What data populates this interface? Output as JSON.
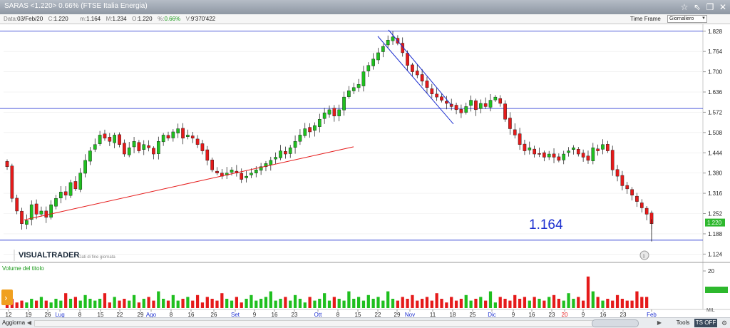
{
  "window": {
    "title": "SARAS <1.220> 0.66%  (FTSE Italia Energia)",
    "icons": [
      "star-icon",
      "expand-arrow-icon",
      "restore-icon",
      "close-icon"
    ]
  },
  "info_bar": {
    "date_label": "Data:",
    "date_value": "03/Feb/20",
    "close_label": "C:",
    "close_value": "1.220",
    "min_label": "m:",
    "min_value": "1.164",
    "max_label": "M:",
    "max_value": "1.234",
    "open_label": "O:",
    "open_value": "1.220",
    "pct_label": "%:",
    "pct_value": "0.66%",
    "volume_label": "V:",
    "volume_value": "9'370'422",
    "timeframe_label": "Time Frame",
    "timeframe_value": "Giornaliero"
  },
  "colors": {
    "up": "#1fbf1f",
    "down": "#e51a1a",
    "trendline": "#e51a1a",
    "channel": "#1c2fd0",
    "hline": "#1c2fd0",
    "accent_text": "#1c2fd0"
  },
  "chart_data": {
    "type": "candlestick",
    "title": "SARAS <1.220> 0.66%",
    "price_axis": {
      "ylim": [
        1.1,
        1.85
      ],
      "ticks": [
        "1.828",
        "1.764",
        "1.700",
        "1.636",
        "1.572",
        "1.508",
        "1.444",
        "1.380",
        "1.316",
        "1.252",
        "1.188",
        "1.124"
      ]
    },
    "last_price_label": "1.220",
    "annotation": "1.164",
    "watermark": "VISUALTRADER",
    "watermark_sub": "Dati di fine giornata",
    "volume_panel": {
      "label": "Volume del titolo",
      "ticks": [
        "20"
      ],
      "axis_unit": "MIL"
    },
    "x_tick_labels": [
      "12",
      "19",
      "26",
      "Lug",
      "8",
      "15",
      "22",
      "29",
      "Ago",
      "8",
      "16",
      "26",
      "Set",
      "9",
      "16",
      "23",
      "Ott",
      "8",
      "15",
      "22",
      "29",
      "Nov",
      "11",
      "18",
      "25",
      "Dic",
      "9",
      "16",
      "23",
      "20",
      "9",
      "16",
      "23",
      "Feb"
    ],
    "highlight_ticks": [
      "Lug",
      "Ago",
      "Set",
      "Ott",
      "Nov",
      "Dic",
      "Feb"
    ],
    "red_ticks": [
      "20"
    ],
    "horizontal_lines": [
      1.828,
      1.584,
      1.168
    ],
    "trendline": {
      "from": [
        1.232,
        34
      ],
      "to": [
        1.463,
        496
      ]
    },
    "channel": {
      "upper": [
        [
          1.832,
          545
        ],
        [
          1.595,
          633
        ]
      ],
      "lower": [
        [
          1.812,
          530
        ],
        [
          1.535,
          636
        ]
      ]
    },
    "candles": [
      1.4,
      1.3,
      1.26,
      1.22,
      1.23,
      1.28,
      1.25,
      1.26,
      1.24,
      1.28,
      1.3,
      1.32,
      1.31,
      1.35,
      1.33,
      1.38,
      1.42,
      1.45,
      1.47,
      1.5,
      1.49,
      1.48,
      1.5,
      1.47,
      1.44,
      1.46,
      1.48,
      1.45,
      1.47,
      1.46,
      1.44,
      1.48,
      1.5,
      1.49,
      1.51,
      1.52,
      1.49,
      1.5,
      1.49,
      1.47,
      1.45,
      1.42,
      1.39,
      1.38,
      1.37,
      1.38,
      1.39,
      1.38,
      1.36,
      1.37,
      1.38,
      1.39,
      1.4,
      1.41,
      1.42,
      1.43,
      1.45,
      1.44,
      1.46,
      1.48,
      1.5,
      1.52,
      1.51,
      1.53,
      1.55,
      1.57,
      1.58,
      1.56,
      1.58,
      1.62,
      1.64,
      1.65,
      1.66,
      1.7,
      1.72,
      1.74,
      1.76,
      1.78,
      1.8,
      1.81,
      1.79,
      1.76,
      1.72,
      1.7,
      1.69,
      1.67,
      1.65,
      1.63,
      1.62,
      1.61,
      1.6,
      1.59,
      1.58,
      1.57,
      1.59,
      1.61,
      1.58,
      1.6,
      1.59,
      1.61,
      1.62,
      1.6,
      1.55,
      1.52,
      1.5,
      1.47,
      1.45,
      1.46,
      1.44,
      1.44,
      1.43,
      1.44,
      1.43,
      1.42,
      1.44,
      1.45,
      1.46,
      1.44,
      1.43,
      1.42,
      1.46,
      1.45,
      1.47,
      1.45,
      1.39,
      1.37,
      1.34,
      1.33,
      1.31,
      1.29,
      1.27,
      1.25,
      1.22
    ],
    "volume": [
      4,
      5,
      3,
      4,
      3,
      5,
      4,
      6,
      4,
      3,
      5,
      4,
      8,
      5,
      6,
      4,
      7,
      5,
      4,
      5,
      8,
      3,
      6,
      4,
      5,
      4,
      7,
      3,
      5,
      6,
      4,
      9,
      5,
      4,
      7,
      4,
      5,
      6,
      4,
      7,
      3,
      6,
      5,
      4,
      8,
      5,
      4,
      6,
      3,
      5,
      7,
      4,
      5,
      6,
      9,
      4,
      5,
      6,
      4,
      7,
      5,
      3,
      6,
      4,
      5,
      8,
      4,
      6,
      5,
      4,
      9,
      5,
      6,
      4,
      7,
      5,
      6,
      4,
      9,
      5,
      4,
      6,
      5,
      7,
      4,
      5,
      6,
      4,
      8,
      5,
      3,
      6,
      4,
      5,
      7,
      4,
      5,
      6,
      4,
      9,
      3,
      6,
      5,
      4,
      7,
      5,
      6,
      4,
      6,
      5,
      4,
      6,
      7,
      5,
      4,
      8,
      5,
      6,
      4,
      17,
      9,
      6,
      4,
      5,
      4,
      7,
      5,
      4,
      4,
      9,
      6,
      6
    ]
  },
  "status_bar": {
    "refresh_label": "Aggiorna",
    "tools_label": "Tools",
    "ts_label": "TS OFF"
  }
}
